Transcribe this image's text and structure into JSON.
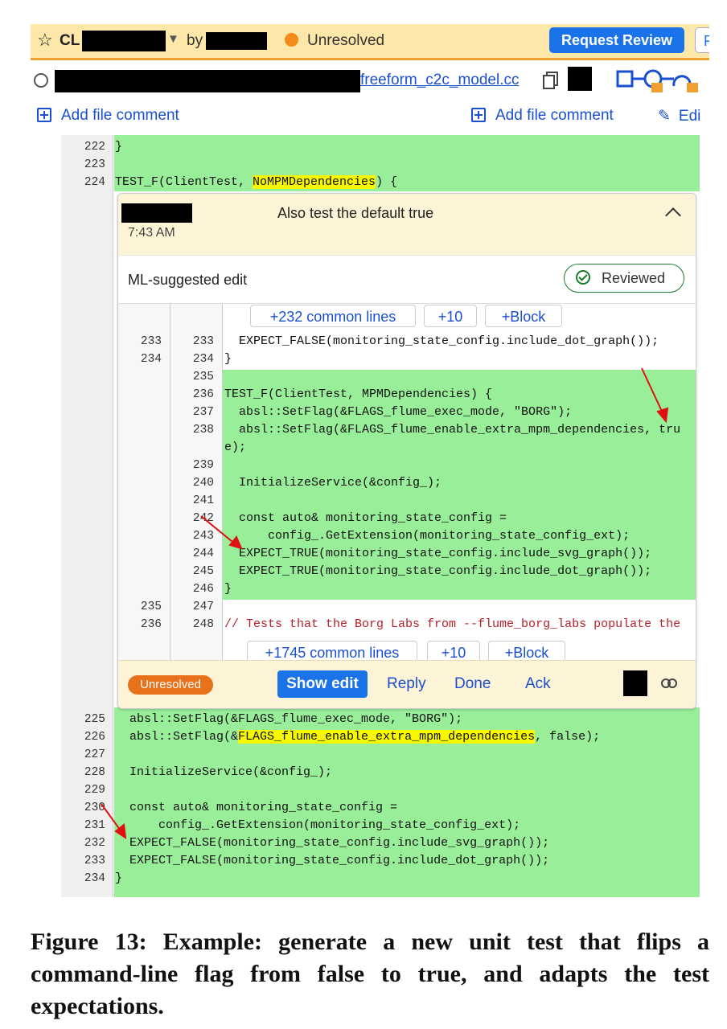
{
  "topbar": {
    "star_icon": "star-outline-icon",
    "cl_label": "CL",
    "by_label": "by",
    "status": "Unresolved",
    "status_color": "#f28b1a",
    "request_review": "Request Review",
    "more_label": "F"
  },
  "filebar": {
    "filename": "freeform_c2c_model.cc"
  },
  "comment_bar": {
    "left": "Add file comment",
    "right": "Add file comment",
    "edit": "Edi"
  },
  "outer_lines": {
    "top": [
      {
        "n": "222",
        "code": "}"
      },
      {
        "n": "223",
        "code": ""
      },
      {
        "n": "224",
        "code_pre": "TEST_F(ClientTest, ",
        "code_hl": "NoMPMDependencies",
        "code_post": ") {"
      }
    ],
    "bottom": [
      {
        "n": "225",
        "code": "  absl::SetFlag(&FLAGS_flume_exec_mode, \"BORG\");"
      },
      {
        "n": "226",
        "code_pre": "  absl::SetFlag(&",
        "code_hl": "FLAGS_flume_enable_extra_mpm_dependencies",
        "code_post": ", false);"
      },
      {
        "n": "227",
        "code": ""
      },
      {
        "n": "228",
        "code": "  InitializeService(&config_);"
      },
      {
        "n": "229",
        "code": ""
      },
      {
        "n": "230",
        "code": "  const auto& monitoring_state_config ="
      },
      {
        "n": "231",
        "code": "      config_.GetExtension(monitoring_state_config_ext);"
      },
      {
        "n": "232",
        "code": "  EXPECT_FALSE(monitoring_state_config.include_svg_graph());"
      },
      {
        "n": "233",
        "code": "  EXPECT_FALSE(monitoring_state_config.include_dot_graph());"
      },
      {
        "n": "234",
        "code": "}"
      }
    ]
  },
  "card": {
    "title": "Also test the default true",
    "time": "7:43 AM",
    "ml_title": "ML-suggested edit",
    "reviewed": "Reviewed",
    "common_top": "+232 common lines",
    "plus10": "+10",
    "block": "+Block",
    "common_bottom": "+1745 common lines",
    "diff_lines": [
      {
        "a": "233",
        "b": "233",
        "code": "  EXPECT_FALSE(monitoring_state_config.include_dot_graph());"
      },
      {
        "a": "234",
        "b": "234",
        "code": "}"
      },
      {
        "a": "",
        "b": "235",
        "code": ""
      },
      {
        "a": "",
        "b": "236",
        "code": "TEST_F(ClientTest, MPMDependencies) {"
      },
      {
        "a": "",
        "b": "237",
        "code": "  absl::SetFlag(&FLAGS_flume_exec_mode, \"BORG\");"
      },
      {
        "a": "",
        "b": "238",
        "code": "  absl::SetFlag(&FLAGS_flume_enable_extra_mpm_dependencies, tru"
      },
      {
        "a": "",
        "b": "",
        "code": "e);"
      },
      {
        "a": "",
        "b": "239",
        "code": ""
      },
      {
        "a": "",
        "b": "240",
        "code": "  InitializeService(&config_);"
      },
      {
        "a": "",
        "b": "241",
        "code": ""
      },
      {
        "a": "",
        "b": "242",
        "code": "  const auto& monitoring_state_config ="
      },
      {
        "a": "",
        "b": "243",
        "code": "      config_.GetExtension(monitoring_state_config_ext);"
      },
      {
        "a": "",
        "b": "244",
        "code": "  EXPECT_TRUE(monitoring_state_config.include_svg_graph());"
      },
      {
        "a": "",
        "b": "245",
        "code": "  EXPECT_TRUE(monitoring_state_config.include_dot_graph());"
      },
      {
        "a": "",
        "b": "246",
        "code": "}"
      },
      {
        "a": "235",
        "b": "247",
        "code": ""
      },
      {
        "a": "236",
        "b": "248",
        "code": "// Tests that the Borg Labs from --flume_borg_labs populate the"
      }
    ],
    "footer": {
      "status": "Unresolved",
      "show_edit": "Show edit",
      "reply": "Reply",
      "done": "Done",
      "ack": "Ack"
    }
  },
  "caption": "Figure 13: Example: generate a new unit test that flips a command-line flag from false to true, and adapts the test expectations."
}
